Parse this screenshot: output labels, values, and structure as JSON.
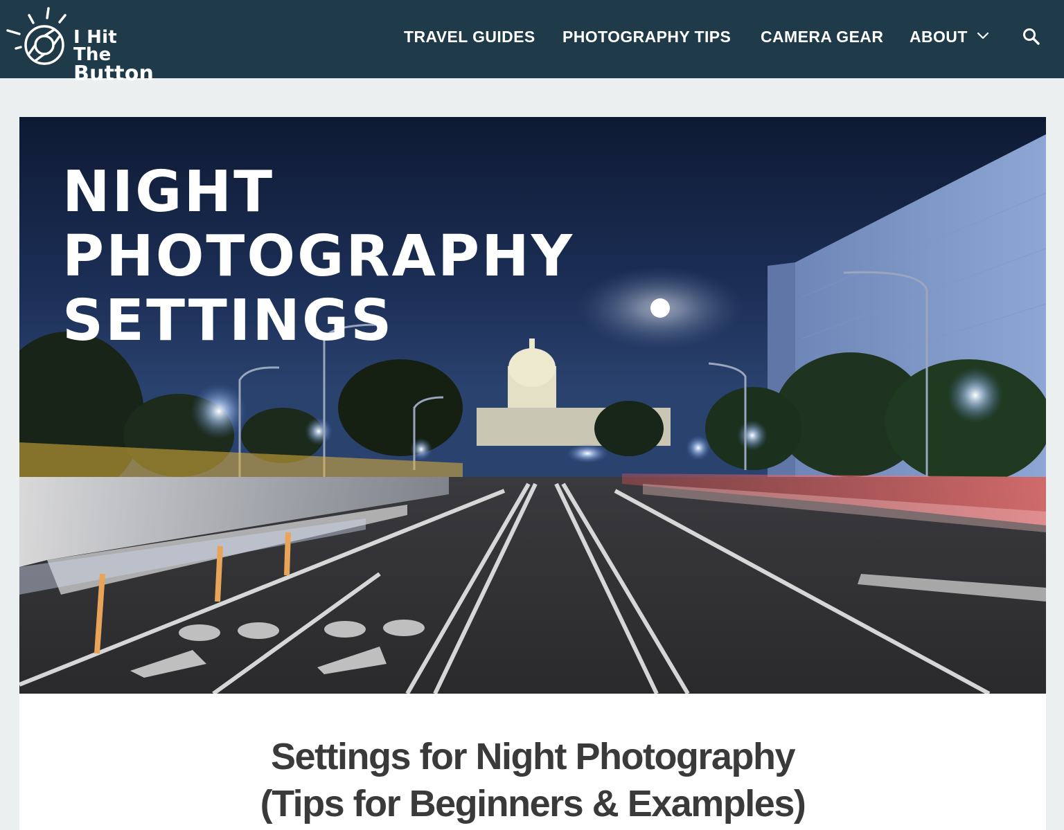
{
  "site": {
    "logo_line1": "I Hit The",
    "logo_line2": "Button",
    "logo_icon": "camera-aperture-sun-icon"
  },
  "nav": {
    "items": [
      {
        "label": "TRAVEL GUIDES"
      },
      {
        "label": "PHOTOGRAPHY TIPS"
      },
      {
        "label": "CAMERA GEAR"
      },
      {
        "label": "ABOUT"
      }
    ],
    "about_dropdown_icon": "chevron-down-icon",
    "search_icon": "search-icon"
  },
  "hero": {
    "title_lines": [
      "NIGHT",
      "PHOTOGRAPHY",
      "SETTINGS"
    ],
    "image_subject": "night-street-long-exposure-capitol"
  },
  "post": {
    "title_lines": [
      "Settings for Night Photography",
      "(Tips for Beginners & Examples)"
    ]
  },
  "colors": {
    "header_bg": "#1f3a48",
    "page_bg": "#eceff0",
    "title_text": "#3a3a3a"
  }
}
